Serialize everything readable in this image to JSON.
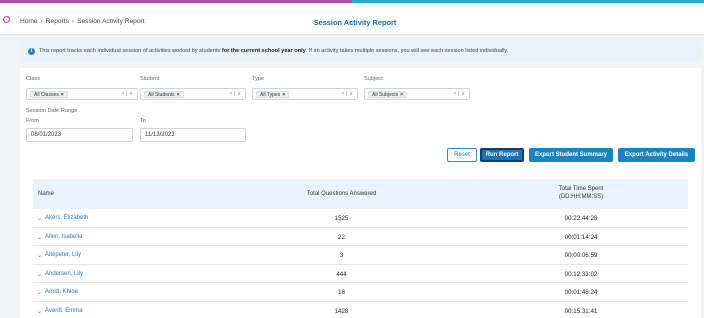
{
  "breadcrumb": [
    "Home",
    "Reports",
    "Session Activity Report"
  ],
  "page_title": "Session Activity Report",
  "info": {
    "text_before": "This report tracks each individual session of activities worked by students ",
    "text_bold": "for the current school year only",
    "text_after": ". If an activity takes multiple sessions, you will see each session listed individually."
  },
  "filters": {
    "class": {
      "label": "Class",
      "chip": "All Classes"
    },
    "student": {
      "label": "Student",
      "chip": "All Students"
    },
    "type": {
      "label": "Type",
      "chip": "All Types"
    },
    "subject": {
      "label": "Subject",
      "chip": "All Subjects"
    },
    "clear_symbol": "×",
    "dropdown_symbol": "∨"
  },
  "date_range": {
    "label": "Session Date Range",
    "from_label": "From",
    "from_value": "08/01/2023",
    "to_label": "To",
    "to_value": "11/13/2023"
  },
  "buttons": {
    "reset": "Reset",
    "run_report": "Run Report",
    "export_student_summary": "Export Student Summary",
    "export_activity_details": "Export Activity Details"
  },
  "table": {
    "columns": {
      "name": "Name",
      "questions": "Total Questions Answered",
      "time_line1": "Total Time Spent",
      "time_line2": "(DD:HH:MM:SS)"
    },
    "rows": [
      {
        "name": "Akers, Elizabeth",
        "questions": "1525",
        "time": "00:22:44:28"
      },
      {
        "name": "Allen, Isabella",
        "questions": "22",
        "time": "00:01:14:24"
      },
      {
        "name": "Altepeter, Lily",
        "questions": "3",
        "time": "00:00:06:59"
      },
      {
        "name": "Andersen, Lily",
        "questions": "444",
        "time": "00:12:33:02"
      },
      {
        "name": "Arndt, Khloe",
        "questions": "18",
        "time": "00:01:48:24"
      },
      {
        "name": "Averitt, Emma",
        "questions": "1428",
        "time": "00:15:31:41"
      }
    ]
  },
  "colors": {
    "accent_purple": "#b04aa6",
    "accent_blue": "#2aa7d4",
    "primary_button": "#1b83c2",
    "link": "#2a78c2"
  }
}
